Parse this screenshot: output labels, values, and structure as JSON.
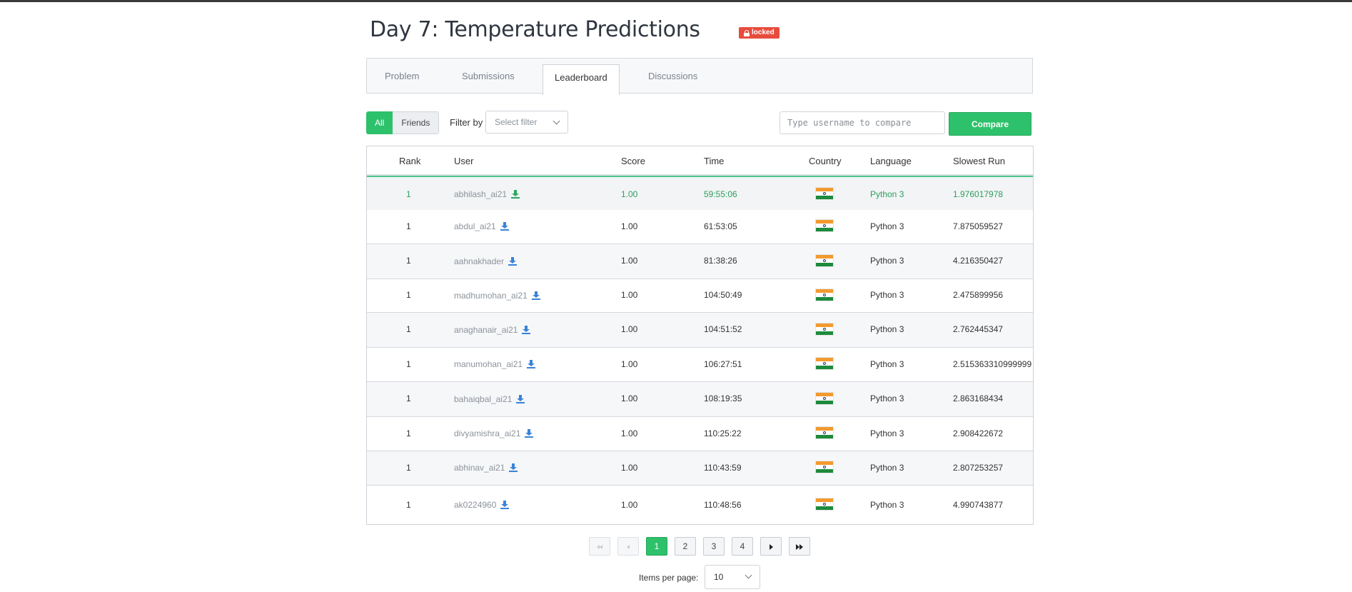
{
  "page": {
    "title": "Day 7: Temperature Predictions",
    "badge": "locked"
  },
  "tabs": [
    {
      "label": "Problem"
    },
    {
      "label": "Submissions"
    },
    {
      "label": "Leaderboard",
      "active": true
    },
    {
      "label": "Discussions"
    }
  ],
  "filters": {
    "all_label": "All",
    "friends_label": "Friends",
    "filter_by_label": "Filter by",
    "filter_select_value": "Select filter",
    "compare_placeholder": "Type username to compare",
    "compare_label": "Compare"
  },
  "table": {
    "headers": [
      "Rank",
      "User",
      "Score",
      "Time",
      "Country",
      "Language",
      "Slowest Run"
    ],
    "rows": [
      {
        "rank": "1",
        "user": "abhilash_ai21",
        "score": "1.00",
        "time": "59:55:06",
        "country": "India",
        "language": "Python 3",
        "slowest": "1.976017978",
        "current_user": true
      },
      {
        "rank": "1",
        "user": "abdul_ai21",
        "score": "1.00",
        "time": "61:53:05",
        "country": "India",
        "language": "Python 3",
        "slowest": "7.875059527"
      },
      {
        "rank": "1",
        "user": "aahnakhader",
        "score": "1.00",
        "time": "81:38:26",
        "country": "India",
        "language": "Python 3",
        "slowest": "4.216350427"
      },
      {
        "rank": "1",
        "user": "madhumohan_ai21",
        "score": "1.00",
        "time": "104:50:49",
        "country": "India",
        "language": "Python 3",
        "slowest": "2.475899956"
      },
      {
        "rank": "1",
        "user": "anaghanair_ai21",
        "score": "1.00",
        "time": "104:51:52",
        "country": "India",
        "language": "Python 3",
        "slowest": "2.762445347"
      },
      {
        "rank": "1",
        "user": "manumohan_ai21",
        "score": "1.00",
        "time": "106:27:51",
        "country": "India",
        "language": "Python 3",
        "slowest": "2.515363310999999"
      },
      {
        "rank": "1",
        "user": "bahaiqbal_ai21",
        "score": "1.00",
        "time": "108:19:35",
        "country": "India",
        "language": "Python 3",
        "slowest": "2.863168434"
      },
      {
        "rank": "1",
        "user": "divyamishra_ai21",
        "score": "1.00",
        "time": "110:25:22",
        "country": "India",
        "language": "Python 3",
        "slowest": "2.908422672"
      },
      {
        "rank": "1",
        "user": "abhinav_ai21",
        "score": "1.00",
        "time": "110:43:59",
        "country": "India",
        "language": "Python 3",
        "slowest": "2.807253257"
      },
      {
        "rank": "1",
        "user": "ak0224960",
        "score": "1.00",
        "time": "110:48:56",
        "country": "India",
        "language": "Python 3",
        "slowest": "4.990743877"
      }
    ]
  },
  "pagination": {
    "pages": [
      "1",
      "2",
      "3",
      "4"
    ],
    "current": "1",
    "items_per_page_label": "Items per page:",
    "items_per_page_value": "10"
  },
  "colors": {
    "accent": "#2ec16b",
    "danger": "#e74c3c",
    "link": "#3a82d8"
  }
}
